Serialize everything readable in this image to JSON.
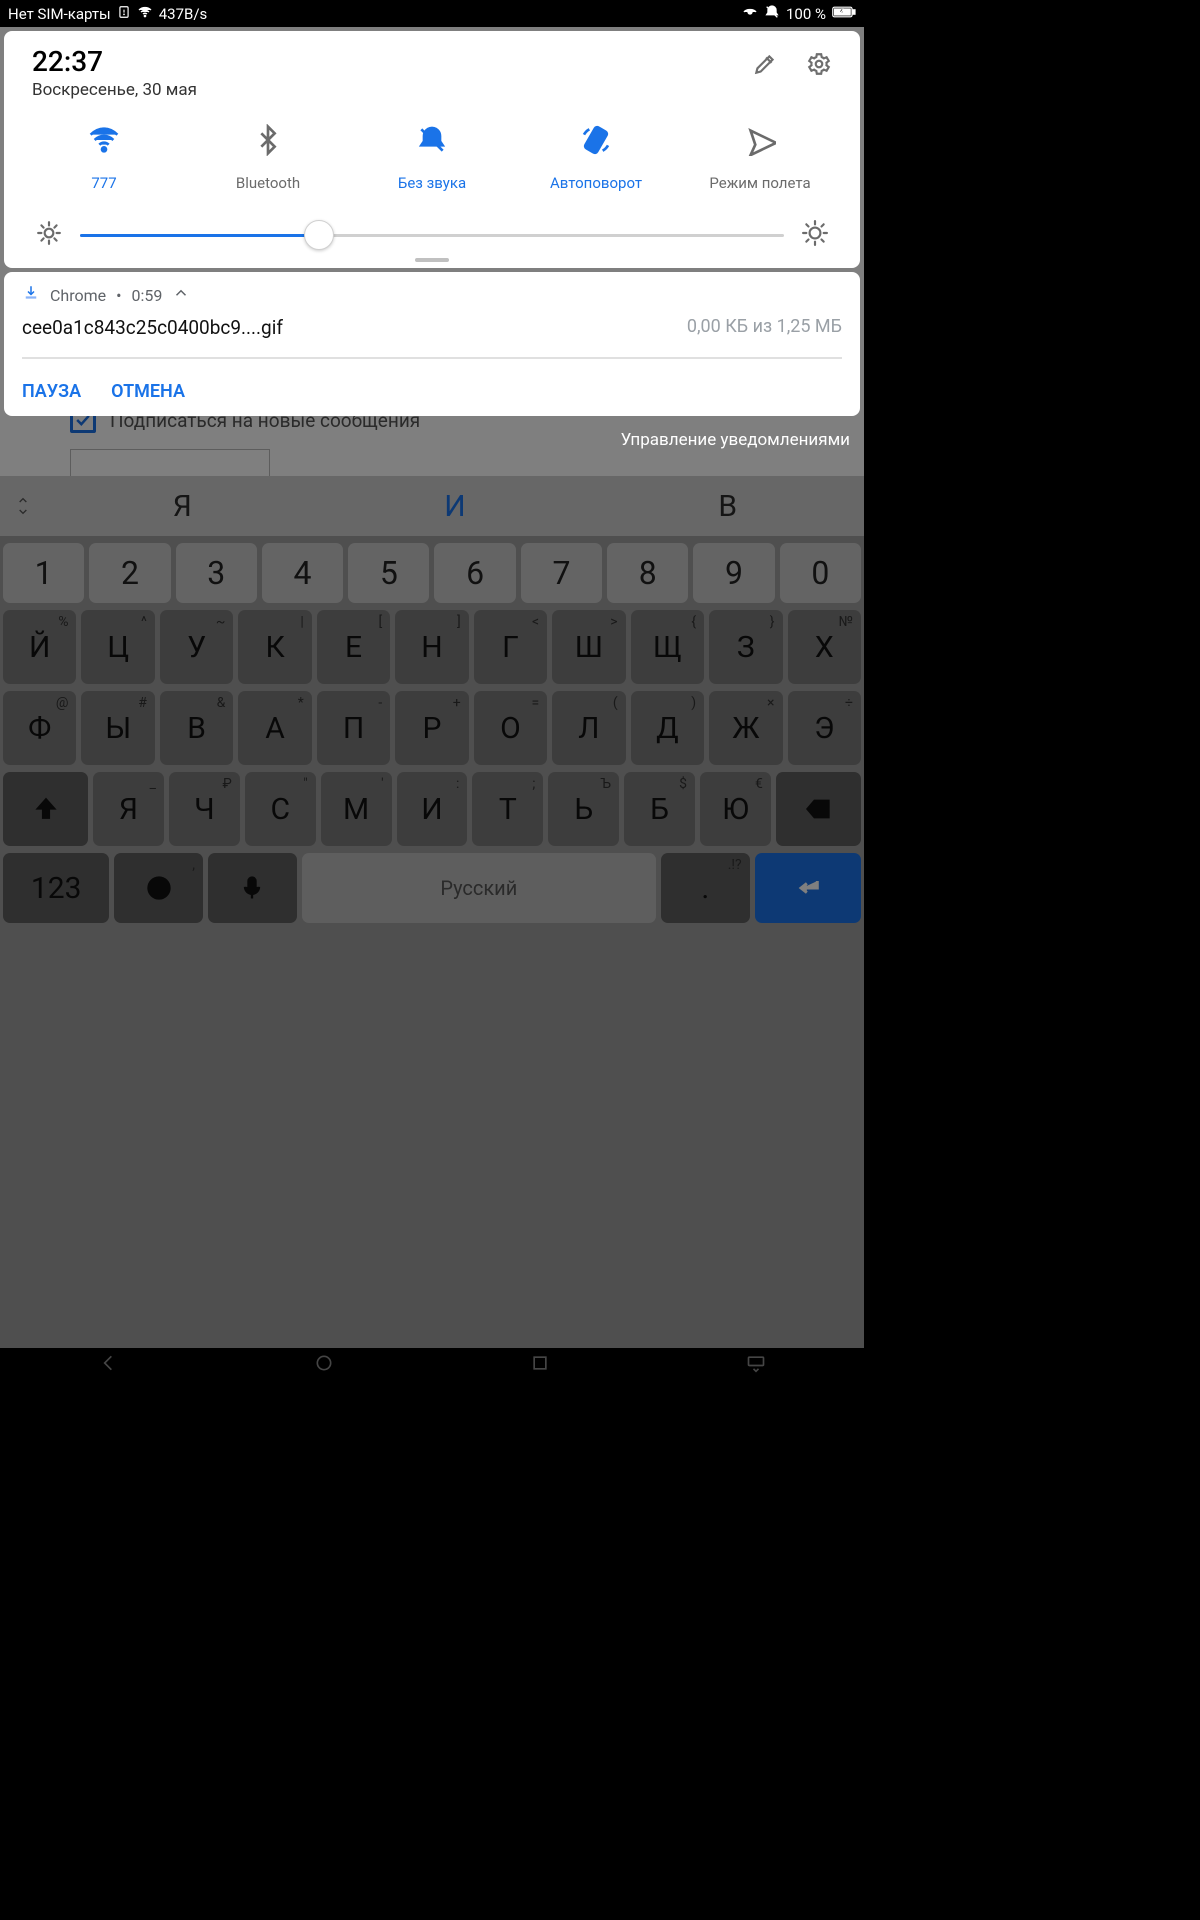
{
  "status": {
    "left_text": "Нет SIM-карты",
    "speed": "437B/s",
    "battery_pct": "100 %"
  },
  "qs": {
    "time": "22:37",
    "date": "Воскресенье, 30 мая",
    "tiles": [
      {
        "id": "wifi",
        "label": "777",
        "active": true
      },
      {
        "id": "bluetooth",
        "label": "Bluetooth",
        "active": false
      },
      {
        "id": "mute",
        "label": "Без звука",
        "active": true
      },
      {
        "id": "rotate",
        "label": "Автоповорот",
        "active": true
      },
      {
        "id": "airplane",
        "label": "Режим полета",
        "active": false
      }
    ]
  },
  "notif": {
    "app": "Chrome",
    "time": "0:59",
    "filename": "cee0a1c843c25c0400bc9....gif",
    "size": "0,00 КБ из 1,25 МБ",
    "action_pause": "ПАУЗА",
    "action_cancel": "ОТМЕНА"
  },
  "shade_footer": {
    "subscribe_label": "Подписаться на новые сообщения",
    "manage_label": "Управление уведомлениями"
  },
  "suggestions": {
    "a": "Я",
    "b": "И",
    "c": "В"
  },
  "keyboard": {
    "numrow": [
      "1",
      "2",
      "3",
      "4",
      "5",
      "6",
      "7",
      "8",
      "9",
      "0"
    ],
    "row1": [
      {
        "m": "Й",
        "s": "%"
      },
      {
        "m": "Ц",
        "s": "^"
      },
      {
        "m": "У",
        "s": "~"
      },
      {
        "m": "К",
        "s": "|"
      },
      {
        "m": "Е",
        "s": "["
      },
      {
        "m": "Н",
        "s": "]"
      },
      {
        "m": "Г",
        "s": "<"
      },
      {
        "m": "Ш",
        "s": ">"
      },
      {
        "m": "Щ",
        "s": "{"
      },
      {
        "m": "З",
        "s": "}"
      },
      {
        "m": "Х",
        "s": "№"
      }
    ],
    "row2": [
      {
        "m": "Ф",
        "s": "@"
      },
      {
        "m": "Ы",
        "s": "#"
      },
      {
        "m": "В",
        "s": "&"
      },
      {
        "m": "А",
        "s": "*"
      },
      {
        "m": "П",
        "s": "-"
      },
      {
        "m": "Р",
        "s": "+"
      },
      {
        "m": "О",
        "s": "="
      },
      {
        "m": "Л",
        "s": "("
      },
      {
        "m": "Д",
        "s": ")"
      },
      {
        "m": "Ж",
        "s": "×"
      },
      {
        "m": "Э",
        "s": "÷"
      }
    ],
    "row3": [
      {
        "m": "Я",
        "s": "_"
      },
      {
        "m": "Ч",
        "s": "₽"
      },
      {
        "m": "С",
        "s": "\""
      },
      {
        "m": "М",
        "s": "'"
      },
      {
        "m": "И",
        "s": ":"
      },
      {
        "m": "Т",
        "s": ";"
      },
      {
        "m": "Ь",
        "s": "Ъ"
      },
      {
        "m": "Б",
        "s": "$"
      },
      {
        "m": "Ю",
        "s": "€"
      }
    ],
    "mode_key": "123",
    "comma": ",",
    "space_label": "Русский",
    "period": ".",
    "period_s": ".!?"
  }
}
